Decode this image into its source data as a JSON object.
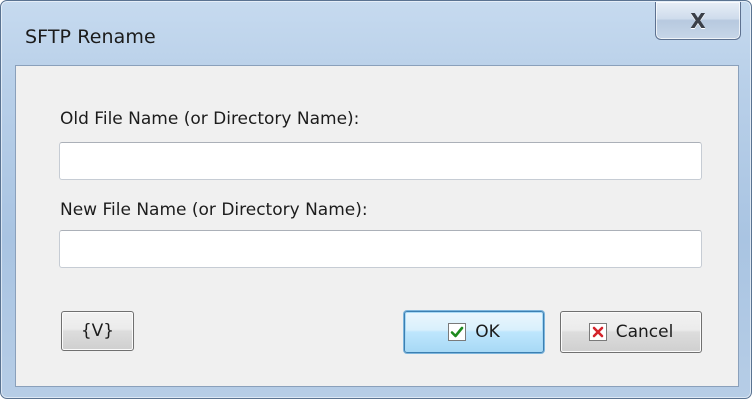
{
  "window": {
    "title": "SFTP Rename",
    "close_label": "X"
  },
  "form": {
    "old_name_label": "Old File Name (or Directory Name):",
    "old_name_value": "",
    "new_name_label": "New File Name (or Directory Name):",
    "new_name_value": ""
  },
  "buttons": {
    "variables_label": "{V}",
    "ok_label": "OK",
    "cancel_label": "Cancel"
  },
  "icons": {
    "ok_icon": "check-icon",
    "cancel_icon": "x-icon",
    "check_color": "#1f8a1f",
    "x_color": "#d4232b"
  }
}
